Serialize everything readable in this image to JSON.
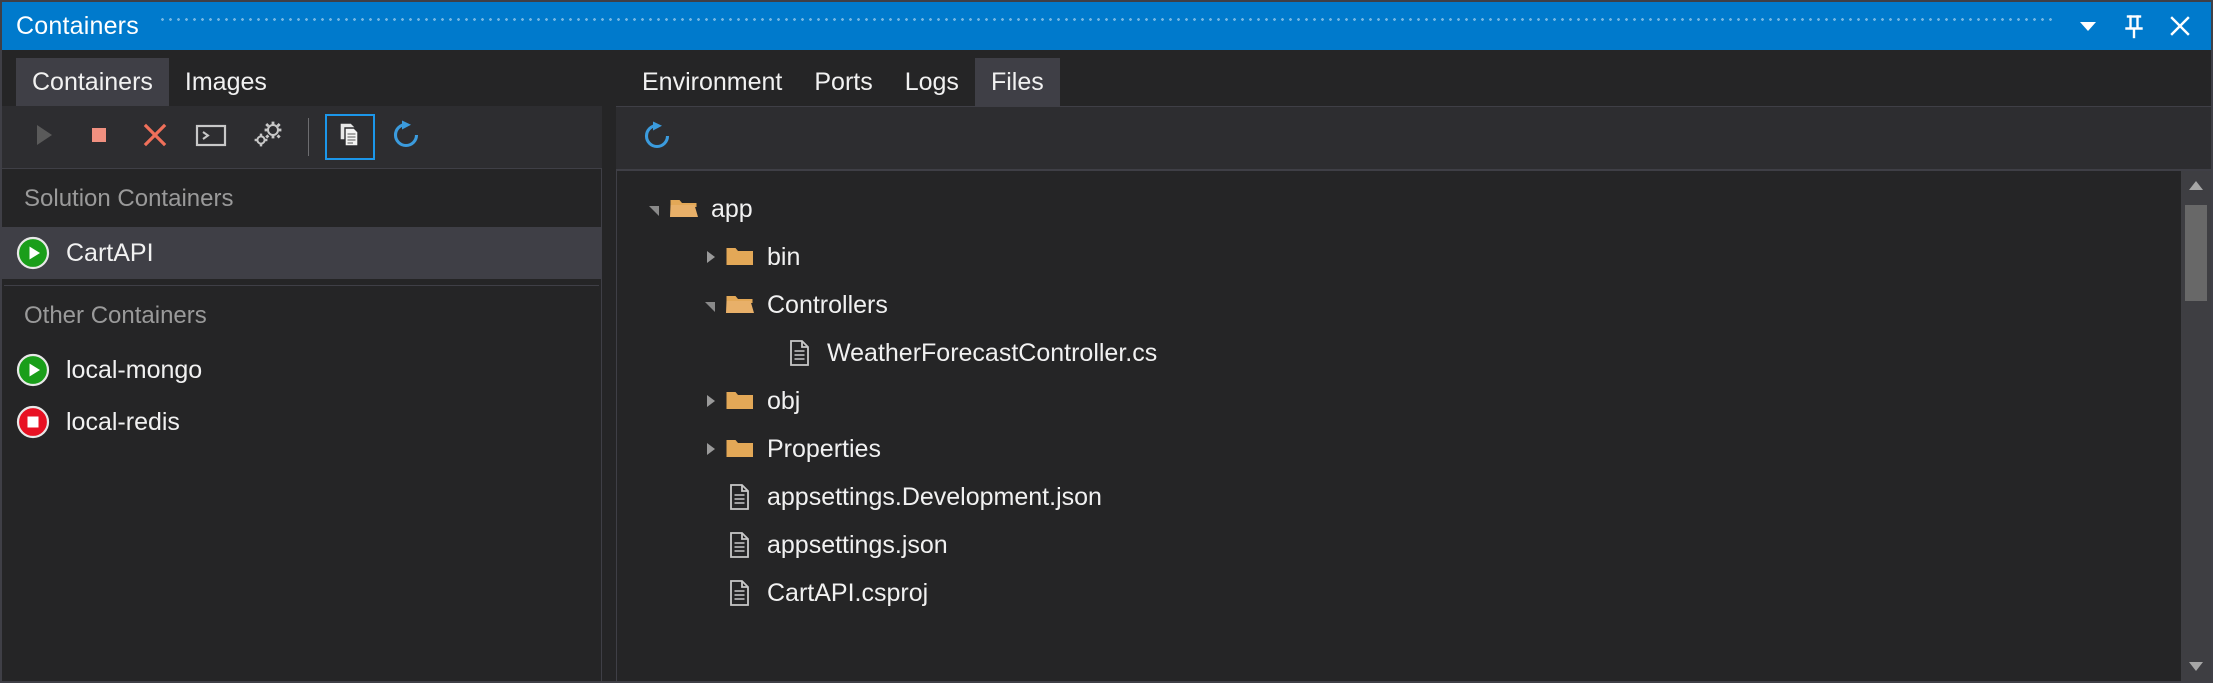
{
  "window": {
    "title": "Containers",
    "buttons": [
      {
        "name": "window-dropdown",
        "icon": "chevron-down-icon",
        "label": "Window position dropdown"
      },
      {
        "name": "auto-hide-pin",
        "icon": "pin-icon",
        "label": "Auto Hide"
      },
      {
        "name": "close-window",
        "icon": "close-icon",
        "label": "Close"
      }
    ]
  },
  "left_panel": {
    "tabs": [
      {
        "label": "Containers",
        "selected": true
      },
      {
        "label": "Images",
        "selected": false
      }
    ],
    "toolbar": [
      {
        "name": "start-container-button",
        "icon": "play-icon",
        "state": "disabled"
      },
      {
        "name": "stop-container-button",
        "icon": "stop-icon",
        "state": "enabled"
      },
      {
        "name": "remove-container-button",
        "icon": "remove-x-icon",
        "state": "enabled"
      },
      {
        "name": "open-terminal-button",
        "icon": "terminal-icon",
        "state": "enabled"
      },
      {
        "name": "container-settings-button",
        "icon": "gears-icon",
        "state": "enabled"
      },
      {
        "name": "view-details-button",
        "icon": "copy-files-icon",
        "state": "active"
      },
      {
        "name": "refresh-containers-button",
        "icon": "refresh-icon",
        "state": "enabled"
      }
    ],
    "groups": [
      {
        "header": "Solution Containers",
        "items": [
          {
            "name": "CartAPI",
            "status": "running",
            "selected": true
          }
        ]
      },
      {
        "header": "Other Containers",
        "items": [
          {
            "name": "local-mongo",
            "status": "running",
            "selected": false
          },
          {
            "name": "local-redis",
            "status": "stopped",
            "selected": false
          }
        ]
      }
    ]
  },
  "right_panel": {
    "tabs": [
      {
        "label": "Environment",
        "selected": false
      },
      {
        "label": "Ports",
        "selected": false
      },
      {
        "label": "Logs",
        "selected": false
      },
      {
        "label": "Files",
        "selected": true
      }
    ],
    "toolbar": [
      {
        "name": "refresh-files-button",
        "icon": "refresh-icon",
        "state": "enabled"
      }
    ],
    "file_tree": [
      {
        "label": "app",
        "type": "folder",
        "expanded": true,
        "depth": 0
      },
      {
        "label": "bin",
        "type": "folder",
        "expanded": false,
        "depth": 1
      },
      {
        "label": "Controllers",
        "type": "folder",
        "expanded": true,
        "depth": 1
      },
      {
        "label": "WeatherForecastController.cs",
        "type": "file",
        "depth": 2
      },
      {
        "label": "obj",
        "type": "folder",
        "expanded": false,
        "depth": 1
      },
      {
        "label": "Properties",
        "type": "folder",
        "expanded": false,
        "depth": 1
      },
      {
        "label": "appsettings.Development.json",
        "type": "file",
        "depth": 1
      },
      {
        "label": "appsettings.json",
        "type": "file",
        "depth": 1
      },
      {
        "label": "CartAPI.csproj",
        "type": "file",
        "depth": 1
      }
    ],
    "scrollbar": {
      "up_arrow": "▲",
      "down_arrow": "▼"
    }
  },
  "colors": {
    "titlebar": "#007acc",
    "accent_blue": "#1c97ea",
    "window_bg": "#252526",
    "toolbar_bg": "#2d2d30",
    "selected_bg": "#3f3f46",
    "folder": "#e3a857",
    "running_green": "#16a016",
    "stopped_red": "#e81123",
    "stop_salmon": "#f09080",
    "text": "#f1f1f1",
    "muted_text": "#9a9a9a"
  }
}
